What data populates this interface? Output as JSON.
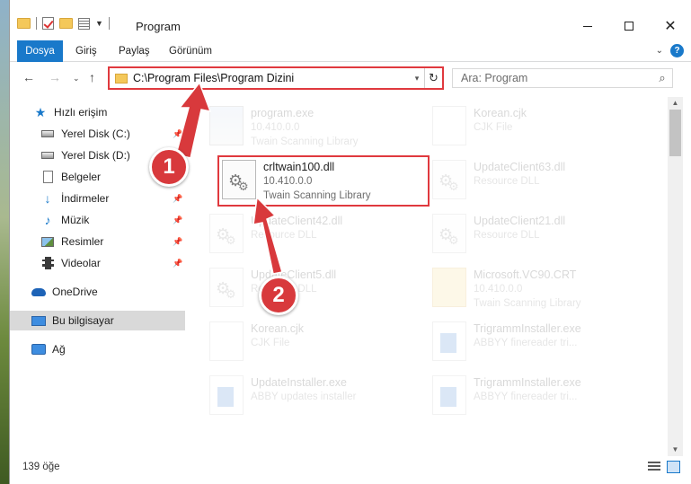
{
  "window": {
    "title": "Program",
    "controls": {
      "minimize": "minimize-icon",
      "maximize": "maximize-icon",
      "close": "✕"
    }
  },
  "ribbon": {
    "tabs": [
      "Dosya",
      "Giriş",
      "Paylaş",
      "Görünüm"
    ],
    "help": "?"
  },
  "nav": {
    "address": "C:\\Program Files\\Program Dizini",
    "search_placeholder": "Ara: Program"
  },
  "sidebar": {
    "items": [
      {
        "label": "Hızlı erişim",
        "icon": "star-icon",
        "pinned": false
      },
      {
        "label": "Yerel Disk (C:)",
        "icon": "drive-icon",
        "pinned": true
      },
      {
        "label": "Yerel Disk (D:)",
        "icon": "drive-icon",
        "pinned": true
      },
      {
        "label": "Belgeler",
        "icon": "documents-icon",
        "pinned": true
      },
      {
        "label": "İndirmeler",
        "icon": "downloads-icon",
        "pinned": true
      },
      {
        "label": "Müzik",
        "icon": "music-icon",
        "pinned": true
      },
      {
        "label": "Resimler",
        "icon": "pictures-icon",
        "pinned": true
      },
      {
        "label": "Videolar",
        "icon": "videos-icon",
        "pinned": true
      },
      {
        "label": "OneDrive",
        "icon": "onedrive-icon",
        "pinned": false
      },
      {
        "label": "Bu bilgisayar",
        "icon": "this-pc-icon",
        "pinned": false
      },
      {
        "label": "Ağ",
        "icon": "network-icon",
        "pinned": false
      }
    ]
  },
  "files": [
    {
      "name": "program.exe",
      "line2": "10.410.0.0",
      "line3": "Twain Scanning Library",
      "type": "prog",
      "faded": true
    },
    {
      "name": "Korean.cjk",
      "line2": "CJK File",
      "line3": "",
      "type": "page",
      "faded": true
    },
    {
      "name": "crltwain100.dll",
      "line2": "10.410.0.0",
      "line3": "Twain Scanning Library",
      "type": "dll",
      "faded": false
    },
    {
      "name": "UpdateClient63.dll",
      "line2": "Resource DLL",
      "line3": "",
      "type": "dll",
      "faded": true
    },
    {
      "name": "UpdateClient42.dll",
      "line2": "Resource DLL",
      "line3": "",
      "type": "dll",
      "faded": true
    },
    {
      "name": "UpdateClient21.dll",
      "line2": "Resource DLL",
      "line3": "",
      "type": "dll",
      "faded": true
    },
    {
      "name": "UpdateClient5.dll",
      "line2": "Resource DLL",
      "line3": "",
      "type": "dll",
      "faded": true
    },
    {
      "name": "Microsoft.VC90.CRT",
      "line2": "10.410.0.0",
      "line3": "Twain Scanning Library",
      "type": "folderico",
      "faded": true
    },
    {
      "name": "Korean.cjk",
      "line2": "CJK File",
      "line3": "",
      "type": "page",
      "faded": true
    },
    {
      "name": "TrigrammInstaller.exe",
      "line2": "ABBYY finereader tri...",
      "line3": "",
      "type": "exe",
      "faded": true
    },
    {
      "name": "UpdateInstaller.exe",
      "line2": "ABBY updates installer",
      "line3": "",
      "type": "exe",
      "faded": true
    },
    {
      "name": "TrigrammInstaller.exe",
      "line2": "ABBYY finereader tri...",
      "line3": "",
      "type": "exe",
      "faded": true
    }
  ],
  "status": {
    "count": "139 öğe"
  },
  "annotations": {
    "callout1": "1",
    "callout2": "2"
  },
  "colors": {
    "accent": "#1979ca",
    "highlight": "#e0393e",
    "callout": "#d8393c"
  }
}
